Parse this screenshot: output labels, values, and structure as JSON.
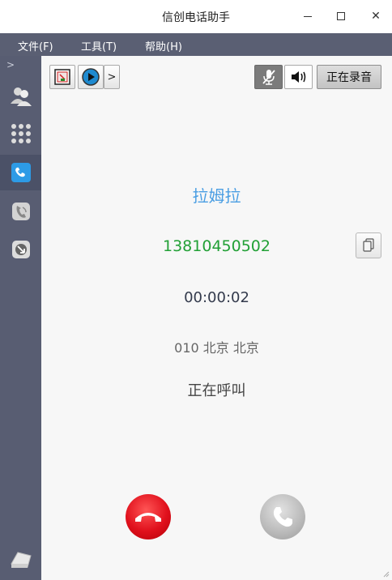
{
  "window": {
    "title": "信创电话助手"
  },
  "menu": {
    "items": [
      "文件(F)",
      "工具(T)",
      "帮助(H)"
    ]
  },
  "sidebar": {
    "expand": ">"
  },
  "toolbar": {
    "more": ">",
    "recording_label": "正在录音"
  },
  "call": {
    "name": "拉姆拉",
    "number": "13810450502",
    "duration": "00:00:02",
    "location": "010 北京 北京",
    "status": "正在呼叫"
  },
  "colors": {
    "name": "#4a9ee3",
    "number": "#22a036",
    "hangup": "#e0101c",
    "answer": "#b9b9b9",
    "sidebar": "#585d72",
    "menubar": "#5a5f73"
  },
  "icons": {
    "close": "✕",
    "maximize": "☐",
    "minimize": "—",
    "volume": "🔊"
  }
}
